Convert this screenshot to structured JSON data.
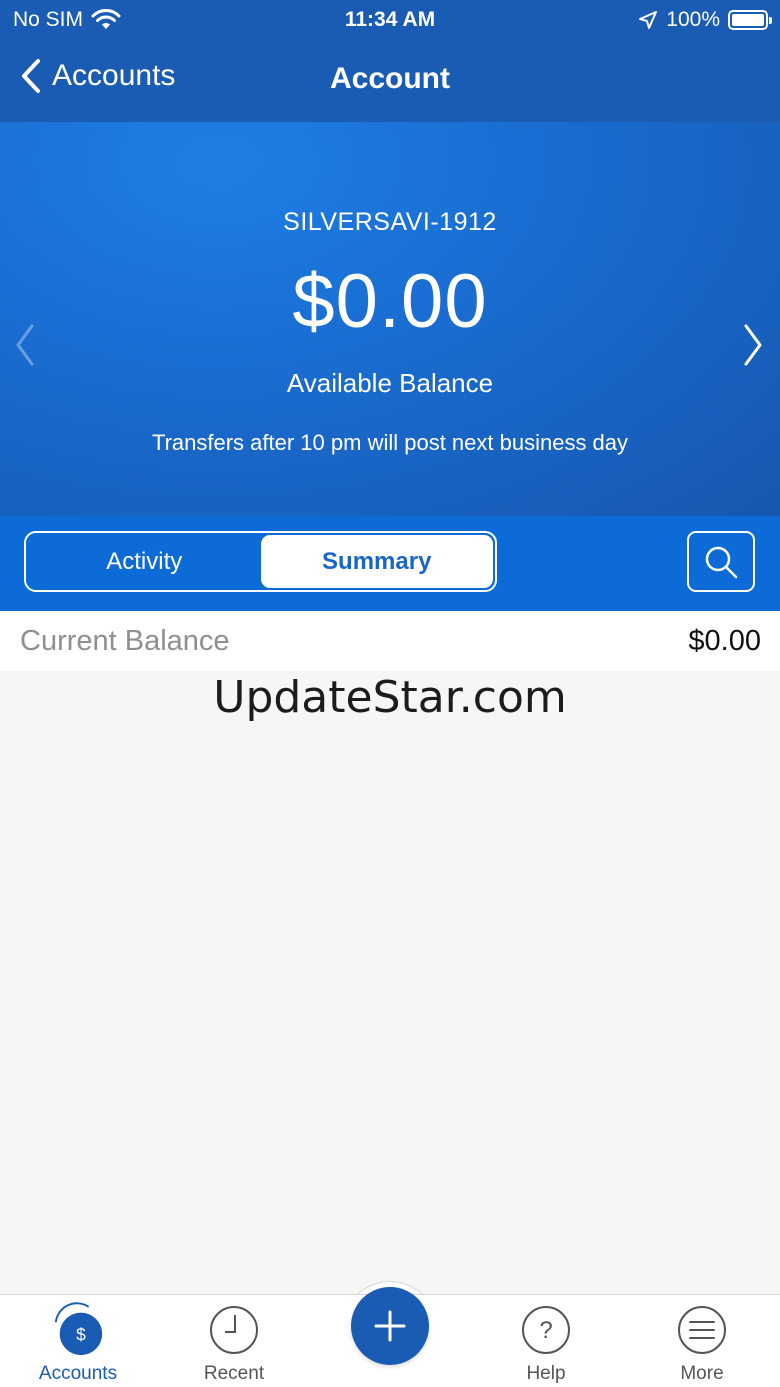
{
  "status_bar": {
    "carrier": "No SIM",
    "time": "11:34 AM",
    "battery": "100%"
  },
  "nav": {
    "back_label": "Accounts",
    "title": "Account"
  },
  "hero": {
    "account_name": "SILVERSAVI-1912",
    "balance": "$0.00",
    "balance_label": "Available Balance",
    "note": "Transfers after 10 pm will post next business day"
  },
  "segments": {
    "activity": "Activity",
    "summary": "Summary",
    "selected": "Summary"
  },
  "summary": {
    "current_balance_label": "Current Balance",
    "current_balance_value": "$0.00"
  },
  "watermark": "UpdateStar.com",
  "tab_bar": {
    "items": [
      {
        "label": "Accounts",
        "icon": "accounts-dollar-icon",
        "active": true
      },
      {
        "label": "Recent",
        "icon": "clock-icon",
        "active": false
      },
      {
        "label": "Help",
        "icon": "help-icon",
        "active": false
      },
      {
        "label": "More",
        "icon": "menu-icon",
        "active": false
      }
    ],
    "fab_icon": "plus-icon"
  },
  "colors": {
    "brand_blue": "#1a5cb4",
    "segment_row_blue": "#0d6bd8",
    "background": "#f7f6f7"
  }
}
